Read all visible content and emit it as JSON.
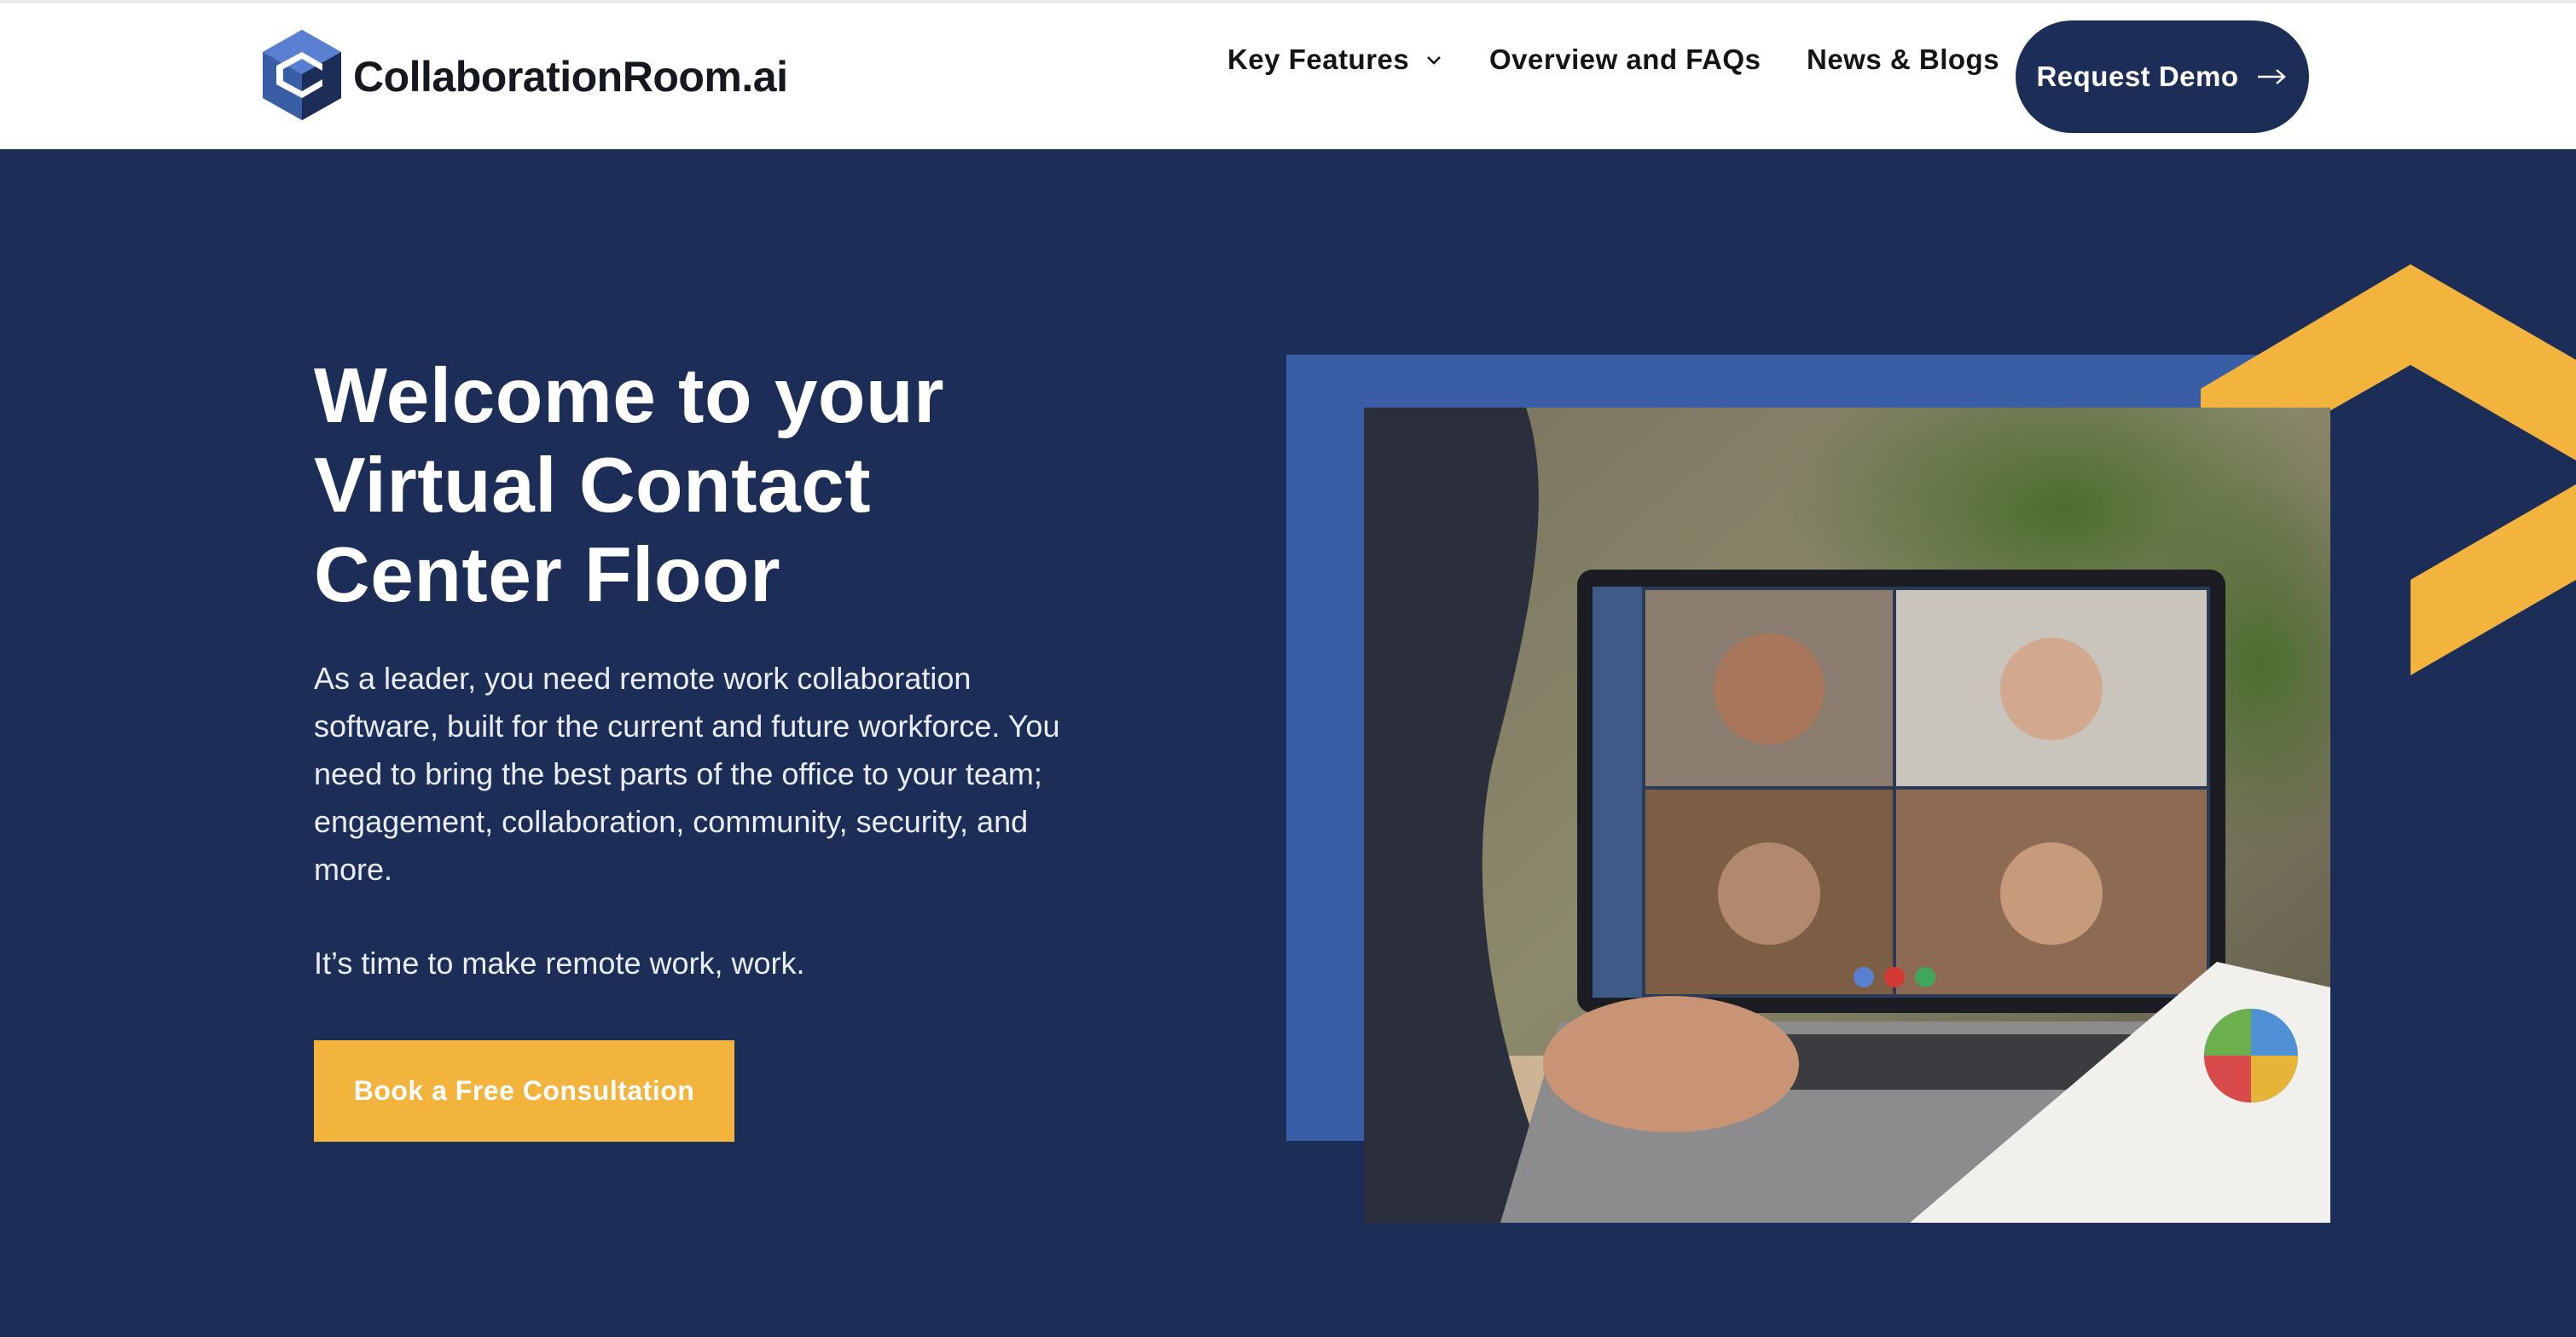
{
  "brand": {
    "name": "CollaborationRoom.ai",
    "logo_icon": "hexagon-c-logo-icon"
  },
  "nav": {
    "items": [
      {
        "label": "Key Features",
        "has_dropdown": true
      },
      {
        "label": "Overview and FAQs"
      },
      {
        "label": "News & Blogs"
      }
    ],
    "cta_label": "Request Demo",
    "cta_icon": "arrow-right-icon"
  },
  "hero": {
    "title_lines": [
      "Welcome to your",
      "Virtual Contact",
      "Center Floor"
    ],
    "body_lines": [
      "As a leader, you need remote work collaboration",
      "software, built for the current and future workforce. You",
      "need to bring the best parts of the office to your team;",
      "engagement, collaboration, community, security, and",
      "more."
    ],
    "tagline": "It’s time to make remote work, work.",
    "cta_label": "Book a Free Consultation"
  },
  "colors": {
    "navy": "#1c2d57",
    "accent_blue": "#3a5ea5",
    "accent_yellow": "#f3b43e",
    "white": "#ffffff"
  }
}
